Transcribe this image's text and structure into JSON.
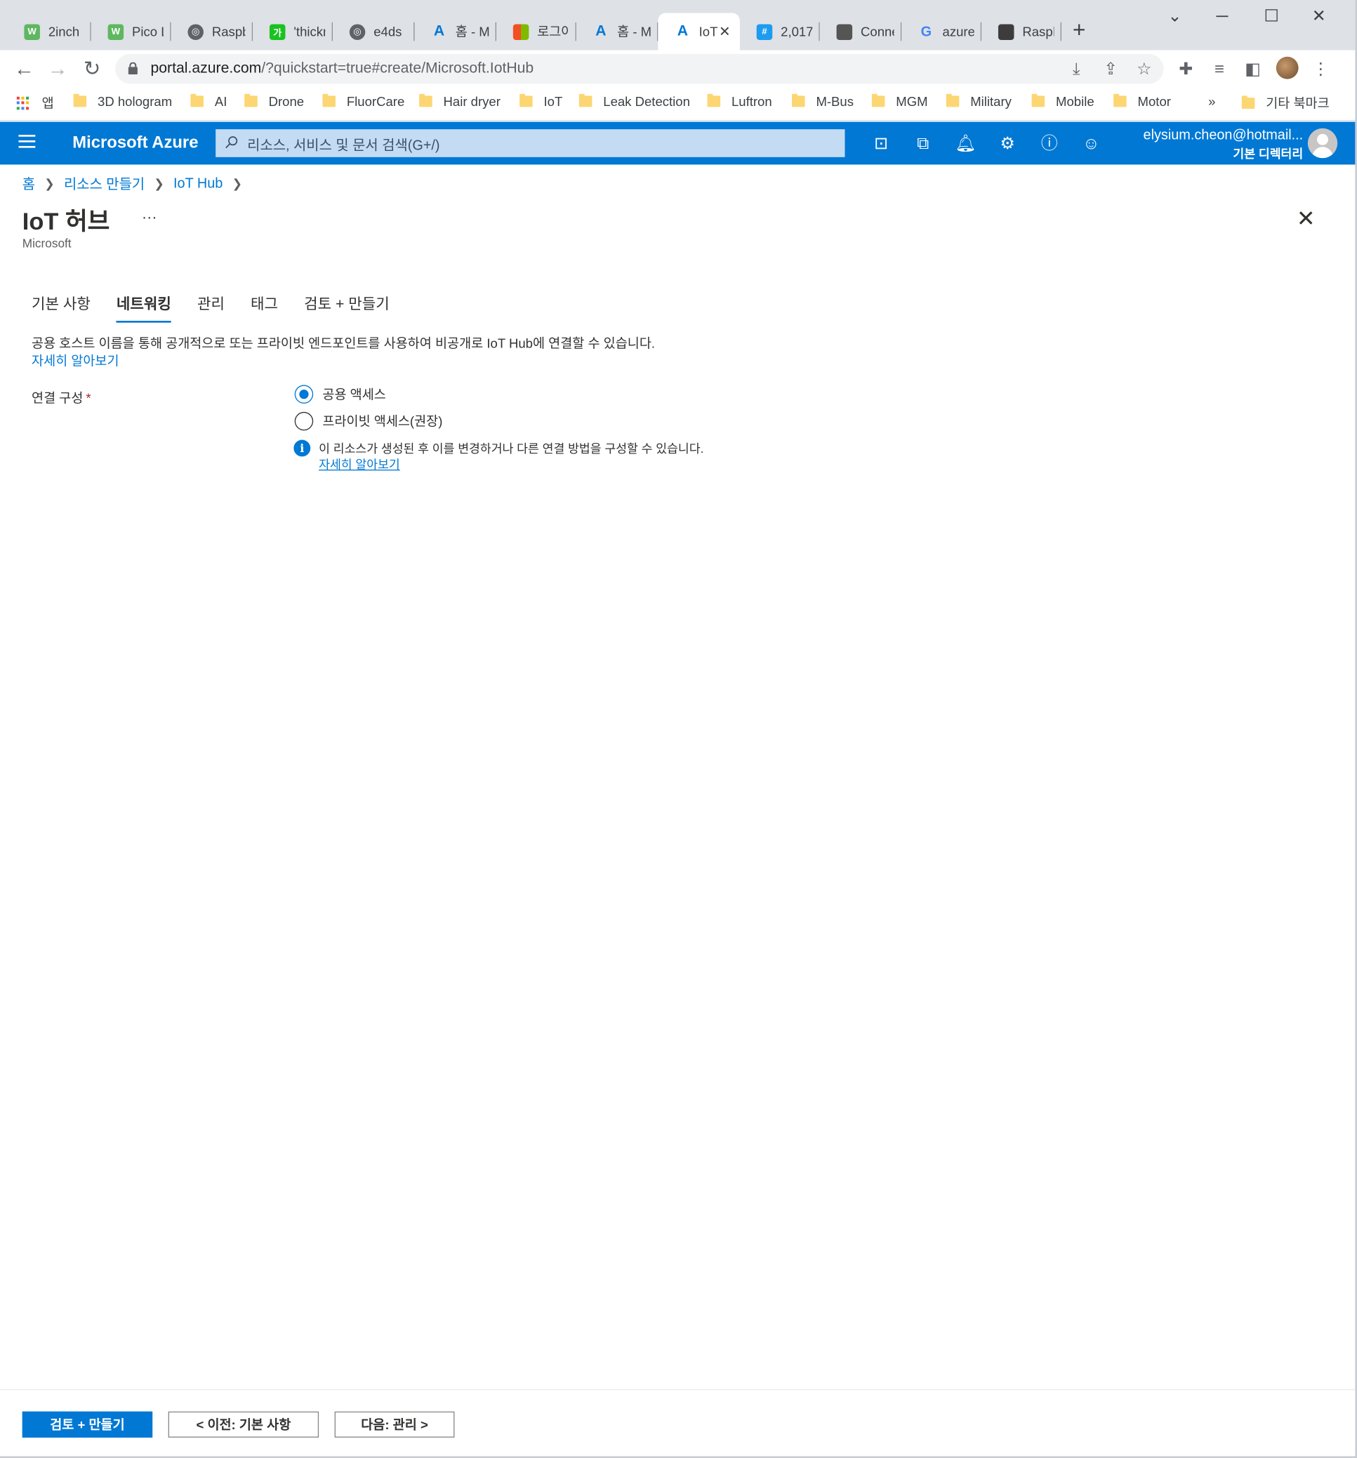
{
  "browser": {
    "tabs": [
      {
        "title": "2inch",
        "icon": "waveshare-icon",
        "color": "#5fb760"
      },
      {
        "title": "Pico LC",
        "icon": "waveshare-icon",
        "color": "#5fb760"
      },
      {
        "title": "Raspbe",
        "icon": "globe-icon",
        "color": "#5f6368"
      },
      {
        "title": "'thickn",
        "icon": "ga-icon",
        "color": "#19c21f"
      },
      {
        "title": "e4ds",
        "icon": "globe-icon",
        "color": "#5f6368"
      },
      {
        "title": "홈 - M",
        "icon": "azure-icon",
        "color": "#0078d4"
      },
      {
        "title": "로그아",
        "icon": "microsoft-icon",
        "color": "#f25022"
      },
      {
        "title": "홈 - M",
        "icon": "azure-icon",
        "color": "#0078d4"
      },
      {
        "title": "IoT",
        "icon": "azure-icon",
        "color": "#0078d4"
      },
      {
        "title": "2,017",
        "icon": "hashnode-icon",
        "color": "#1d9bf0"
      },
      {
        "title": "Conne",
        "icon": "site-icon",
        "color": "#555555"
      },
      {
        "title": "azure",
        "icon": "google-icon",
        "color": "#4285f4"
      },
      {
        "title": "Raspbe",
        "icon": "cube-icon",
        "color": "#3c3c3c"
      }
    ],
    "url_host": "portal.azure.com",
    "url_path": "/?quickstart=true#create/Microsoft.IotHub",
    "bookmarks": {
      "apps": "앱",
      "items": [
        "3D hologram",
        "AI",
        "Drone",
        "FluorCare",
        "Hair dryer",
        "IoT",
        "Leak Detection",
        "Luftron",
        "M-Bus",
        "MGM",
        "Military",
        "Mobile",
        "Motor"
      ],
      "more": "»",
      "other": "기타 북마크"
    }
  },
  "azure": {
    "brand": "Microsoft Azure",
    "search_placeholder": "리소스, 서비스 및 문서 검색(G+/)",
    "user_email": "elysium.cheon@hotmail...",
    "user_directory": "기본 디렉터리",
    "accent": "#0078d4"
  },
  "page": {
    "breadcrumb": [
      "홈",
      "리소스 만들기",
      "IoT Hub"
    ],
    "title": "IoT 허브",
    "more": "...",
    "subtitle": "Microsoft",
    "tabs": [
      "기본 사항",
      "네트워킹",
      "관리",
      "태그",
      "검토 + 만들기"
    ],
    "selected_tab": "네트워킹",
    "description": "공용 호스트 이름을 통해 공개적으로 또는 프라이빗 엔드포인트를 사용하여 비공개로 IoT Hub에 연결할 수 있습니다.",
    "learn_more": "자세히 알아보기",
    "connectivity_label": "연결 구성",
    "required_mark": "*",
    "options": [
      "공용 액세스",
      "프라이빗 액세스(권장)"
    ],
    "selected_option": "공용 액세스",
    "info_text": "이 리소스가 생성된 후 이를 변경하거나 다른 연결 방법을 구성할 수 있습니다.",
    "info_link": "자세히 알아보기"
  },
  "footer": {
    "review_create": "검토 + 만들기",
    "previous": "< 이전: 기본 사항",
    "next": "다음: 관리 >"
  }
}
